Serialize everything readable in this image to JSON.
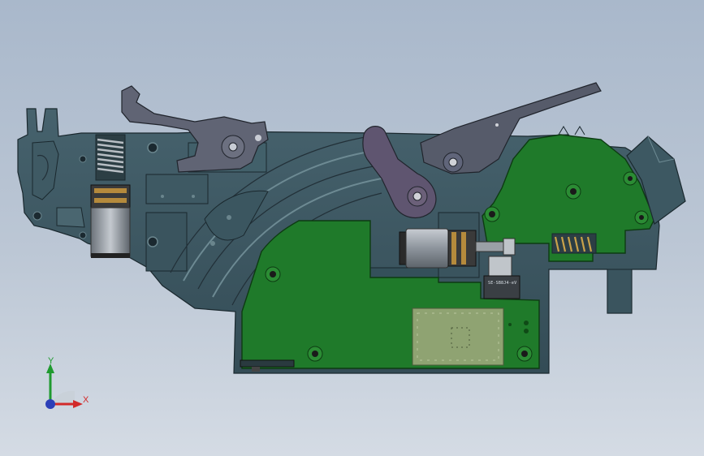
{
  "viewport": {
    "background_top": "#a9b8cb",
    "background_bottom": "#d4dbe4"
  },
  "model": {
    "housing_color": "#3b5560",
    "housing_edge": "#1d2c32",
    "pcb_color": "#1f7a2a",
    "lever_color": "#5a5f6e",
    "part_label": "SE-SB8J4-eV"
  },
  "triad": {
    "x_label": "X",
    "y_label": "Y",
    "x_color": "#d22a2a",
    "y_color": "#1f9a2f",
    "z_color": "#2b3fb8"
  }
}
